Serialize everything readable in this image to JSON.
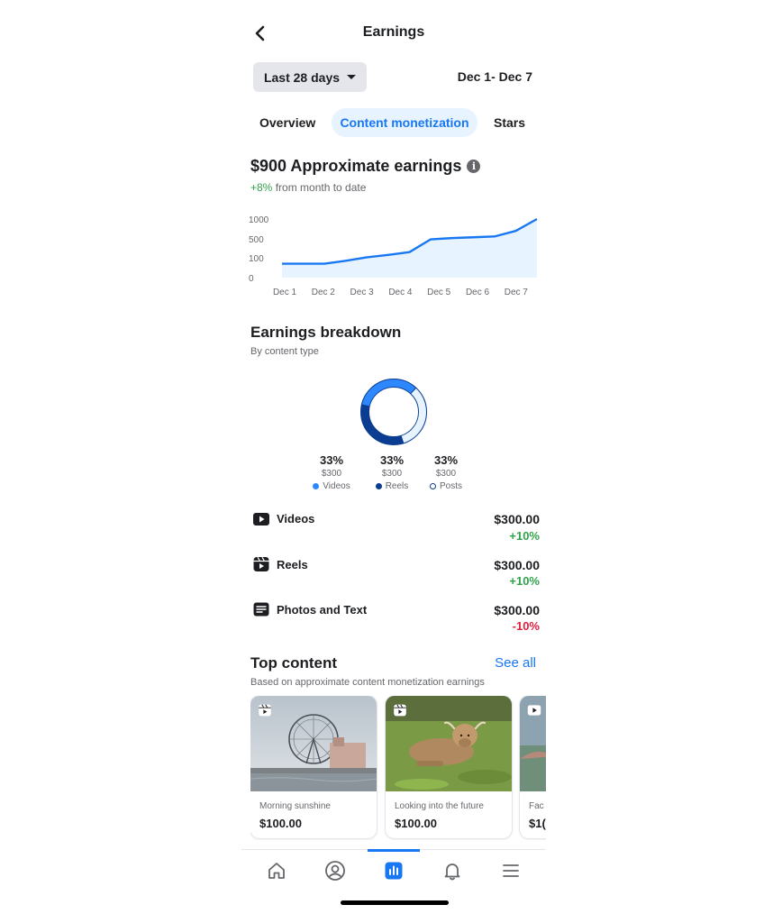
{
  "header": {
    "title": "Earnings"
  },
  "filters": {
    "range_label": "Last 28 days",
    "date_range": "Dec 1- Dec 7"
  },
  "tabs": [
    {
      "label": "Overview",
      "active": false
    },
    {
      "label": "Content monetization",
      "active": true
    },
    {
      "label": "Stars",
      "active": false
    }
  ],
  "earnings": {
    "amount_title": "$900 Approximate earnings",
    "change": "+8%",
    "change_suffix": " from month to date"
  },
  "chart_data": {
    "type": "area",
    "categories": [
      "Dec 1",
      "Dec 2",
      "Dec 3",
      "Dec 4",
      "Dec 5",
      "Dec 6",
      "Dec 7"
    ],
    "y_tick_labels": [
      "1000",
      "500",
      "100",
      "0"
    ],
    "x": [
      "Dec 1",
      "Dec 1.5",
      "Dec 2",
      "Dec 2.5",
      "Dec 3",
      "Dec 3.5",
      "Dec 4",
      "Dec 4.5",
      "Dec 5",
      "Dec 5.5",
      "Dec 6",
      "Dec 6.5",
      "Dec 7"
    ],
    "values": [
      70,
      70,
      70,
      85,
      110,
      160,
      220,
      490,
      520,
      540,
      560,
      700,
      1000
    ],
    "ylim": [
      0,
      1000
    ],
    "grid": false,
    "line_color": "#1877f2",
    "fill_color": "#e7f3ff"
  },
  "breakdown": {
    "title": "Earnings breakdown",
    "subtitle": "By content type",
    "segments": [
      {
        "pct": "33%",
        "amount": "$300",
        "label": "Videos",
        "fraction": 0.333,
        "color": "#2d88ff"
      },
      {
        "pct": "33%",
        "amount": "$300",
        "label": "Reels",
        "fraction": 0.333,
        "color": "#0a3d91"
      },
      {
        "pct": "33%",
        "amount": "$300",
        "label": "Posts",
        "fraction": 0.334,
        "color": "#e7f3ff"
      }
    ],
    "rows": [
      {
        "label": "Videos",
        "amount": "$300.00",
        "change": "+10%",
        "icon": "video-icon"
      },
      {
        "label": "Reels",
        "amount": "$300.00",
        "change": "+10%",
        "icon": "reels-icon"
      },
      {
        "label": "Photos and Text",
        "amount": "$300.00",
        "change": "-10%",
        "icon": "post-icon"
      }
    ]
  },
  "top_content": {
    "title": "Top content",
    "see_all": "See all",
    "subtitle": "Based on approximate content monetization earnings",
    "cards": [
      {
        "caption": "Morning sunshine",
        "amount": "$100.00",
        "icon": "reels-icon"
      },
      {
        "caption": "Looking into the future",
        "amount": "$100.00",
        "icon": "reels-icon"
      },
      {
        "caption": "Fac",
        "amount": "$1(",
        "icon": "video-icon"
      }
    ]
  },
  "nav": {
    "items": [
      "home-icon",
      "profile-icon",
      "insights-icon",
      "bell-icon",
      "menu-icon"
    ],
    "active_index": 2,
    "active_color": "#1877f2"
  }
}
